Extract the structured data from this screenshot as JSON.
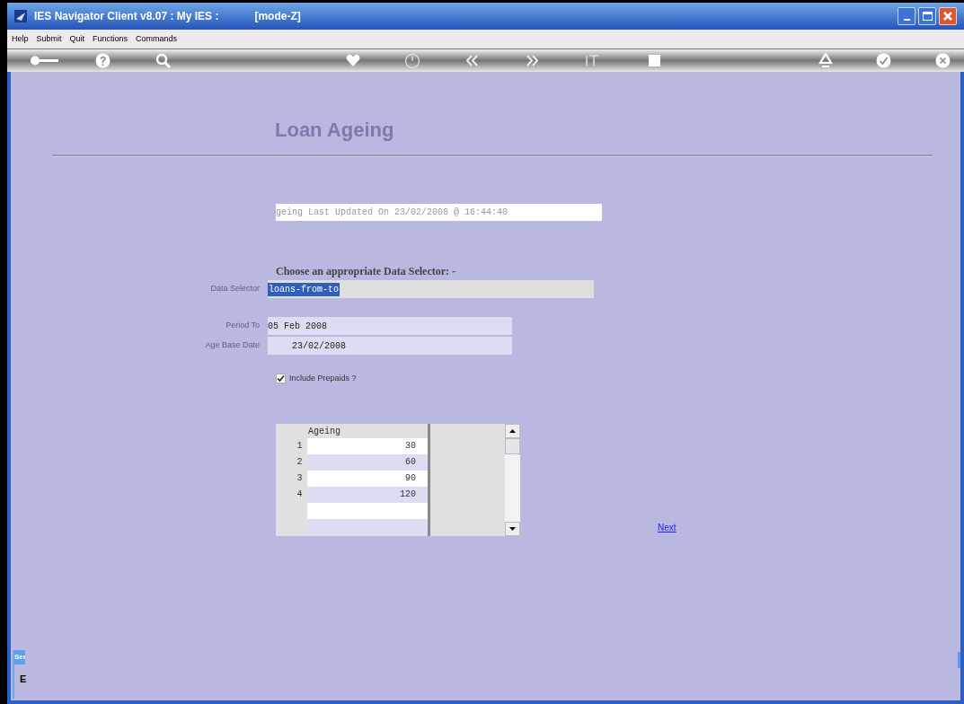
{
  "window": {
    "title": "IES Navigator Client v8.07 : My IES :",
    "mode": "[mode-Z]"
  },
  "menu": [
    "Help",
    "Submit",
    "Quit",
    "Functions",
    "Commands"
  ],
  "page": {
    "title": "Loan Ageing",
    "status": "geing Last Updated On 23/02/2008 @ 16:44:40",
    "prompt": "Choose an appropriate Data Selector: -"
  },
  "fields": [
    {
      "kind": "selector",
      "label": "Data Selector",
      "value": "loans-from-to"
    },
    {
      "kind": "text",
      "label": "Period To",
      "value": "05 Feb 2008"
    },
    {
      "kind": "indented",
      "label": "Age Base Date",
      "value": "23/02/2008"
    }
  ],
  "checkbox": {
    "label": "Include Prepaids ?",
    "checked": true
  },
  "grid": {
    "column": "Ageing",
    "rows": [
      {
        "number": "1",
        "value": "30"
      },
      {
        "number": "2",
        "value": "60"
      },
      {
        "number": "3",
        "value": "90"
      },
      {
        "number": "4",
        "value": "120"
      }
    ]
  },
  "link": "Next",
  "side_tab": {
    "label": "Ser",
    "glyph": "E"
  }
}
